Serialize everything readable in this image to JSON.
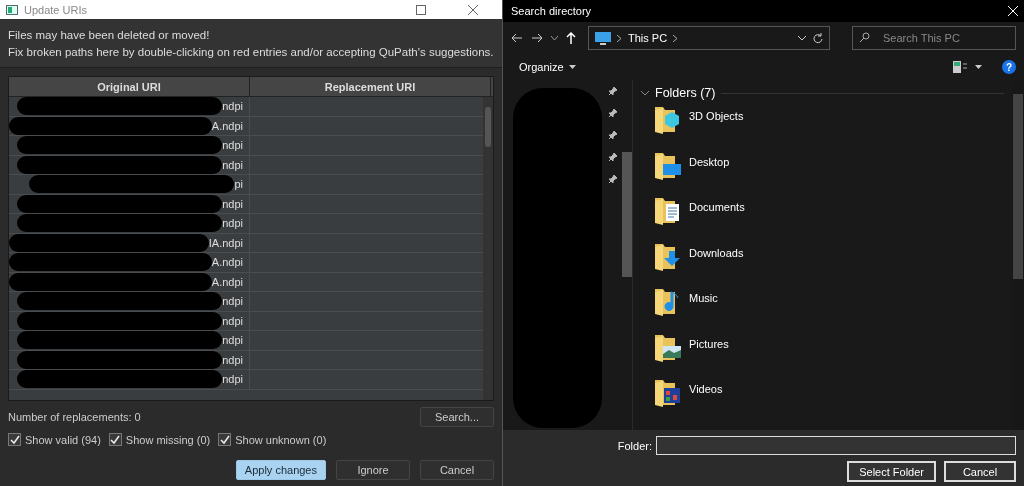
{
  "update_window": {
    "title": "Update URIs",
    "message_lines": [
      "Files may have been deleted or moved!",
      "Fix broken paths here by double-clicking on red entries and/or accepting QuPath's suggestions."
    ],
    "table": {
      "columns": [
        "Original URI",
        "Replacement URI"
      ],
      "rows": [
        {
          "original": "ndpi"
        },
        {
          "original": "A.ndpi"
        },
        {
          "original": "ndpi"
        },
        {
          "original": "ndpi"
        },
        {
          "original": "pi"
        },
        {
          "original": "ndpi"
        },
        {
          "original": "ndpi"
        },
        {
          "original": "IA.ndpi"
        },
        {
          "original": "A.ndpi"
        },
        {
          "original": "A.ndpi"
        },
        {
          "original": "ndpi"
        },
        {
          "original": "ndpi"
        },
        {
          "original": "ndpi"
        },
        {
          "original": "ndpi"
        },
        {
          "original": "ndpi"
        }
      ]
    },
    "replacements": "Number of replacements: 0",
    "search_button": "Search...",
    "filters": [
      {
        "label": "Show valid (94)",
        "checked": true
      },
      {
        "label": "Show missing (0)",
        "checked": true
      },
      {
        "label": "Show unknown (0)",
        "checked": true
      }
    ],
    "buttons": [
      {
        "label": "Apply changes",
        "default": true
      },
      {
        "label": "Ignore",
        "default": false
      },
      {
        "label": "Cancel",
        "default": false
      }
    ]
  },
  "directory_window": {
    "title": "Search directory",
    "address": "This PC",
    "search": {
      "placeholder": "Search This PC"
    },
    "organize": "Organize",
    "help": "?",
    "group": "Folders (7)",
    "folders": [
      "3D Objects",
      "Desktop",
      "Documents",
      "Downloads",
      "Music",
      "Pictures",
      "Videos"
    ],
    "folder_label": "Folder:",
    "buttons": [
      "Select Folder",
      "Cancel"
    ]
  }
}
